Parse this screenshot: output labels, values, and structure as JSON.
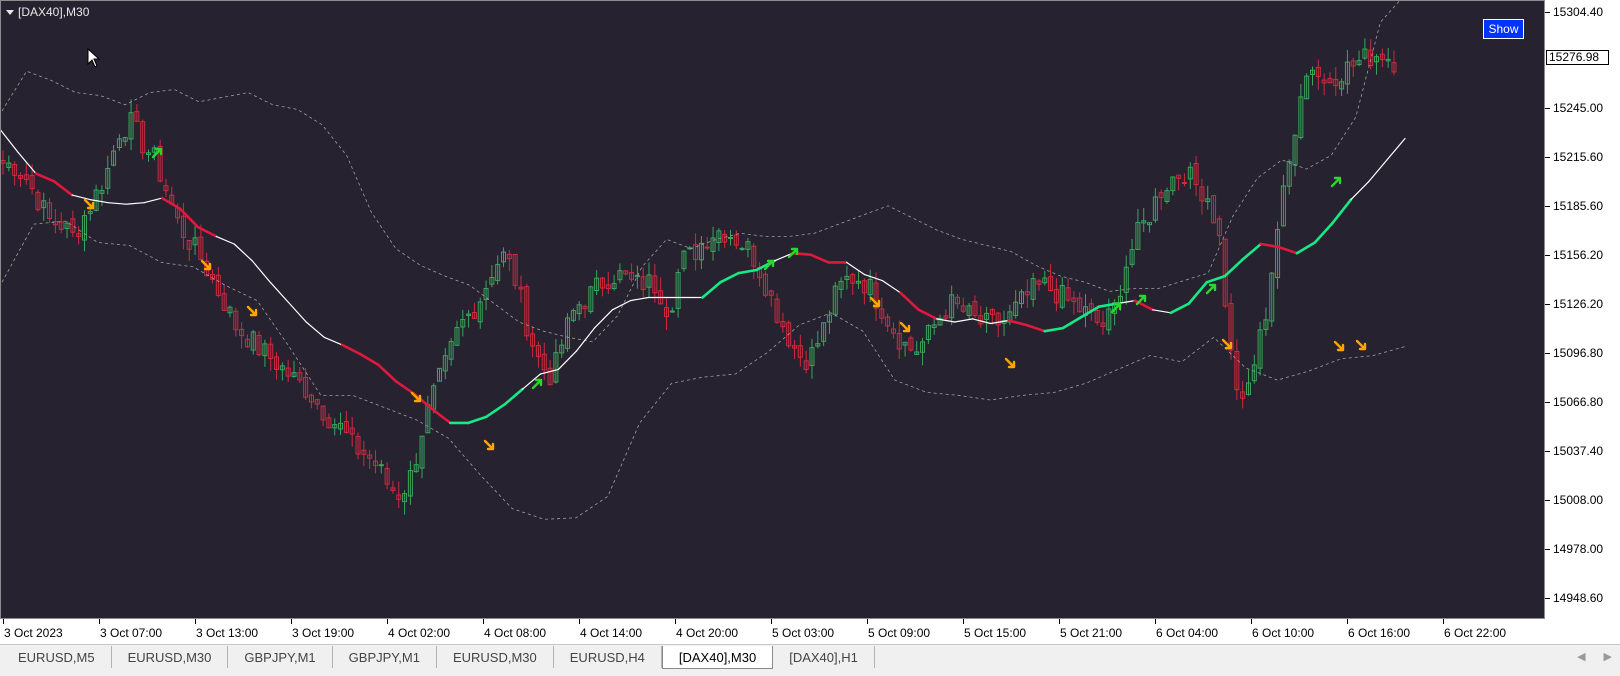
{
  "window": {
    "title": "[DAX40],M30",
    "show_button": "Show"
  },
  "colors": {
    "background": "#26222f",
    "bull": "#3aa55c",
    "bear": "#cf2a3f",
    "ma_neutral": "#ffffff",
    "ma_bull": "#17e985",
    "ma_bear": "#e0183e",
    "band": "#a0a0a0",
    "arrow_up": "#2ad62a",
    "arrow_down": "#ffa400"
  },
  "price_axis": {
    "labels": [
      "15304.40",
      "15245.00",
      "15215.60",
      "15185.60",
      "15156.20",
      "15126.20",
      "15096.80",
      "15066.80",
      "15037.40",
      "15008.00",
      "14978.00",
      "14948.60"
    ],
    "current_price": "15276.98"
  },
  "time_axis": {
    "labels": [
      "3 Oct 2023",
      "3 Oct 07:00",
      "3 Oct 13:00",
      "3 Oct 19:00",
      "4 Oct 02:00",
      "4 Oct 08:00",
      "4 Oct 14:00",
      "4 Oct 20:00",
      "5 Oct 03:00",
      "5 Oct 09:00",
      "5 Oct 15:00",
      "5 Oct 21:00",
      "6 Oct 04:00",
      "6 Oct 10:00",
      "6 Oct 16:00",
      "6 Oct 22:00"
    ]
  },
  "tabs": [
    {
      "label": "EURUSD,M5",
      "active": false
    },
    {
      "label": "EURUSD,M30",
      "active": false
    },
    {
      "label": "GBPJPY,M1",
      "active": false
    },
    {
      "label": "GBPJPY,M1",
      "active": false
    },
    {
      "label": "EURUSD,M30",
      "active": false
    },
    {
      "label": "EURUSD,H4",
      "active": false
    },
    {
      "label": "[DAX40],M30",
      "active": true
    },
    {
      "label": "[DAX40],H1",
      "active": false
    }
  ],
  "tab_nav": {
    "left": "◀",
    "right": "▶"
  },
  "chart_data": {
    "type": "candlestick",
    "symbol": "[DAX40]",
    "timeframe": "M30",
    "ylim": [
      14936,
      15310
    ],
    "anchor_prices": [
      15210,
      15208,
      15200,
      15186,
      15172,
      15170,
      15162,
      15176,
      15190,
      15206,
      15232,
      15236,
      15222,
      15212,
      15192,
      15170,
      15158,
      15147,
      15132,
      15118,
      15102,
      15096,
      15088,
      15082,
      15075,
      15068,
      15062,
      15052,
      15043,
      15036,
      15024,
      15020,
      15012,
      14999,
      14993,
      15007,
      15040,
      15062,
      15080,
      15102,
      15112,
      15124,
      15143,
      15150,
      15130,
      15099,
      15078,
      15070,
      15097,
      15116,
      15122,
      15130,
      15137,
      15136,
      15130,
      15132,
      15130,
      15112,
      15146,
      15150,
      15160,
      15166,
      15165,
      15159,
      15152,
      15136,
      15116,
      15100,
      15085,
      15082,
      15097,
      15120,
      15133,
      15136,
      15130,
      15118,
      15104,
      15092,
      15087,
      15095,
      15108,
      15118,
      15114,
      15108,
      15104,
      15105,
      15108,
      15118,
      15126,
      15130,
      15126,
      15120,
      15115,
      15110,
      15103,
      15112,
      15142,
      15162,
      15175,
      15192,
      15200,
      15205,
      15196,
      15190,
      15165,
      15086,
      15048,
      15078,
      15110,
      15166,
      15208,
      15258,
      15275,
      15262,
      15268,
      15272,
      15276,
      15280,
      15282,
      15277
    ],
    "ma_points": [
      [
        15232,
        "n"
      ],
      [
        15217,
        "n"
      ],
      [
        15203,
        "n"
      ],
      [
        15198,
        "r"
      ],
      [
        15189,
        "r"
      ],
      [
        15186,
        "n"
      ],
      [
        15184,
        "n"
      ],
      [
        15183,
        "n"
      ],
      [
        15184,
        "n"
      ],
      [
        15187,
        "n"
      ],
      [
        15180,
        "r"
      ],
      [
        15168,
        "r"
      ],
      [
        15162,
        "r"
      ],
      [
        15157,
        "n"
      ],
      [
        15146,
        "n"
      ],
      [
        15132,
        "n"
      ],
      [
        15119,
        "n"
      ],
      [
        15106,
        "n"
      ],
      [
        15096,
        "n"
      ],
      [
        15091,
        "n"
      ],
      [
        15085,
        "r"
      ],
      [
        15078,
        "r"
      ],
      [
        15067,
        "r"
      ],
      [
        15059,
        "r"
      ],
      [
        15049,
        "r"
      ],
      [
        15040,
        "r"
      ],
      [
        15040,
        "g"
      ],
      [
        15044,
        "g"
      ],
      [
        15052,
        "g"
      ],
      [
        15062,
        "g"
      ],
      [
        15072,
        "n"
      ],
      [
        15075,
        "n"
      ],
      [
        15087,
        "n"
      ],
      [
        15102,
        "n"
      ],
      [
        15114,
        "n"
      ],
      [
        15120,
        "n"
      ],
      [
        15122,
        "n"
      ],
      [
        15122,
        "n"
      ],
      [
        15122,
        "n"
      ],
      [
        15122,
        "n"
      ],
      [
        15132,
        "g"
      ],
      [
        15138,
        "g"
      ],
      [
        15140,
        "g"
      ],
      [
        15146,
        "g"
      ],
      [
        15151,
        "n"
      ],
      [
        15150,
        "r"
      ],
      [
        15145,
        "r"
      ],
      [
        15145,
        "r"
      ],
      [
        15137,
        "n"
      ],
      [
        15133,
        "n"
      ],
      [
        15125,
        "n"
      ],
      [
        15114,
        "r"
      ],
      [
        15108,
        "r"
      ],
      [
        15106,
        "n"
      ],
      [
        15108,
        "n"
      ],
      [
        15105,
        "n"
      ],
      [
        15107,
        "n"
      ],
      [
        15104,
        "r"
      ],
      [
        15100,
        "r"
      ],
      [
        15102,
        "g"
      ],
      [
        15109,
        "g"
      ],
      [
        15116,
        "g"
      ],
      [
        15118,
        "g"
      ],
      [
        15120,
        "n"
      ],
      [
        15114,
        "r"
      ],
      [
        15112,
        "n"
      ],
      [
        15118,
        "g"
      ],
      [
        15132,
        "g"
      ],
      [
        15136,
        "g"
      ],
      [
        15147,
        "g"
      ],
      [
        15157,
        "g"
      ],
      [
        15155,
        "r"
      ],
      [
        15151,
        "r"
      ],
      [
        15158,
        "g"
      ],
      [
        15171,
        "g"
      ],
      [
        15186,
        "g"
      ],
      [
        15198,
        "n"
      ],
      [
        15212,
        "n"
      ],
      [
        15226,
        "n"
      ]
    ],
    "upper_band": [
      15244,
      15270,
      15264,
      15256,
      15254,
      15248,
      15256,
      15258,
      15250,
      15253,
      15256,
      15248,
      15245,
      15235,
      15215,
      15178,
      15154,
      15143,
      15136,
      15130,
      15118,
      15106,
      15100,
      15096,
      15093,
      15110,
      15142,
      15160,
      15154,
      15160,
      15164,
      15162,
      15162,
      15164,
      15170,
      15176,
      15182,
      15174,
      15166,
      15160,
      15156,
      15152,
      15143,
      15136,
      15132,
      15126,
      15128,
      15128,
      15133,
      15138,
      15175,
      15200,
      15212,
      15206,
      15215,
      15240,
      15302,
      15320
    ],
    "lower_band": [
      15132,
      15170,
      15172,
      15158,
      15156,
      15145,
      15142,
      15130,
      15120,
      15090,
      15058,
      15058,
      15050,
      15042,
      15030,
      15006,
      14984,
      14977,
      14978,
      14992,
      15040,
      15066,
      15070,
      15072,
      15086,
      15104,
      15112,
      15100,
      15068,
      15060,
      15058,
      15055,
      15058,
      15060,
      15066,
      15075,
      15084,
      15080,
      15096,
      15076,
      15068,
      15074,
      15082,
      15084,
      15090
    ]
  }
}
